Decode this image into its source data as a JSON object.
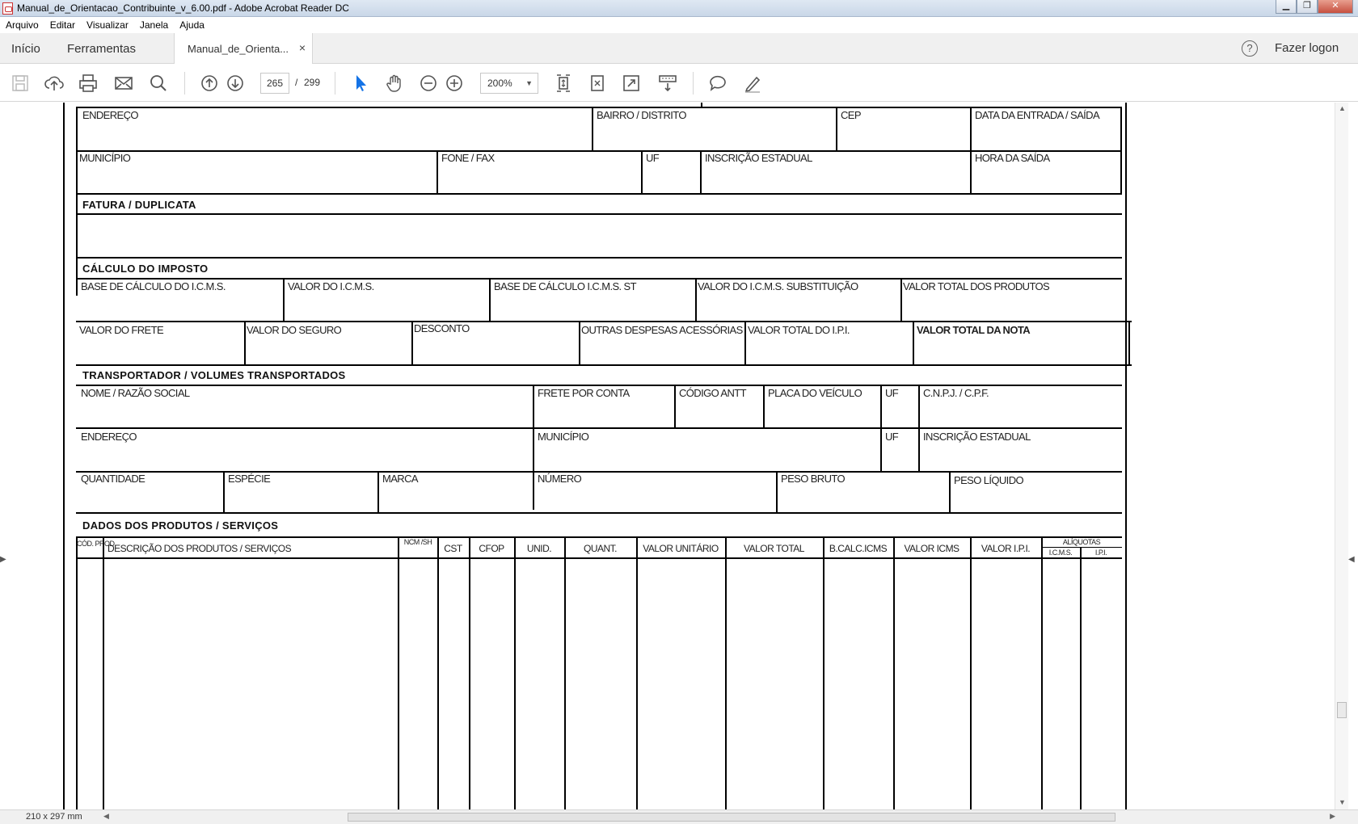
{
  "window": {
    "title": "Manual_de_Orientacao_Contribuinte_v_6.00.pdf - Adobe Acrobat Reader DC",
    "minimize": "▁",
    "maximize": "❐",
    "close": "✕"
  },
  "menu": [
    "Arquivo",
    "Editar",
    "Visualizar",
    "Janela",
    "Ajuda"
  ],
  "tabs": {
    "home": "Início",
    "tools": "Ferramentas",
    "document": "Manual_de_Orienta...",
    "close": "×",
    "help": "?",
    "login": "Fazer logon"
  },
  "toolbar": {
    "page_current": "265",
    "page_separator": "/",
    "page_total": "299",
    "zoom": "200%",
    "icons": [
      "save-icon",
      "upload-icon",
      "print-icon",
      "mail-icon",
      "search-icon",
      "page-up-icon",
      "page-down-icon",
      "select-icon",
      "hand-icon",
      "zoom-out-icon",
      "zoom-in-icon",
      "fit-page-icon",
      "rotate-icon",
      "fullscreen-icon",
      "scroll-mode-icon",
      "comment-icon",
      "highlight-icon"
    ],
    "accent": "#1473e6"
  },
  "form": {
    "row1": [
      "ENDEREÇO",
      "BAIRRO / DISTRITO",
      "CEP",
      "DATA DA ENTRADA / SAÍDA"
    ],
    "row2": [
      "MUNICÍPIO",
      "FONE / FAX",
      "UF",
      "INSCRIÇÃO ESTADUAL",
      "HORA DA SAÍDA"
    ],
    "fatura_title": "FATURA / DUPLICATA",
    "calculo_title": "CÁLCULO DO IMPOSTO",
    "calculo_row1": [
      "BASE DE CÁLCULO DO I.C.M.S.",
      "VALOR DO I.C.M.S.",
      "BASE DE CÁLCULO I.C.M.S. ST",
      "VALOR DO I.C.M.S. SUBSTITUIÇÃO",
      "VALOR TOTAL DOS PRODUTOS"
    ],
    "calculo_row2": [
      "VALOR DO FRETE",
      "VALOR DO SEGURO",
      "DESCONTO",
      "OUTRAS DESPESAS ACESSÓRIAS",
      "VALOR TOTAL DO I.P.I.",
      "VALOR TOTAL DA NOTA"
    ],
    "transp_title": "TRANSPORTADOR / VOLUMES TRANSPORTADOS",
    "transp_row1": [
      "NOME / RAZÃO SOCIAL",
      "FRETE POR CONTA",
      "CÓDIGO ANTT",
      "PLACA DO VEÍCULO",
      "UF",
      "C.N.P.J. / C.P.F."
    ],
    "transp_row2": [
      "ENDEREÇO",
      "MUNICÍPIO",
      "UF",
      "INSCRIÇÃO ESTADUAL"
    ],
    "transp_row3": [
      "QUANTIDADE",
      "ESPÉCIE",
      "MARCA",
      "NÚMERO",
      "PESO BRUTO",
      "PESO LÍQUIDO"
    ],
    "produtos_title": "DADOS DOS PRODUTOS / SERVIÇOS",
    "produtos_cols": {
      "cod": "CÓD. PROD.",
      "desc": "DESCRIÇÃO DOS PRODUTOS / SERVIÇOS",
      "ncm": "NCM /SH",
      "cst": "CST",
      "cfop": "CFOP",
      "unid": "UNID.",
      "quant": "QUANT.",
      "vunit": "VALOR UNITÁRIO",
      "vtotal": "VALOR TOTAL",
      "bcalc": "B.CALC.ICMS",
      "vicms": "VALOR ICMS",
      "vipi": "VALOR I.P.I.",
      "aliq": "ALÍQUOTAS",
      "aliq_icms": "I.C.M.S.",
      "aliq_ipi": "I.P.I."
    }
  },
  "status": {
    "dimensions": "210 x 297 mm"
  }
}
